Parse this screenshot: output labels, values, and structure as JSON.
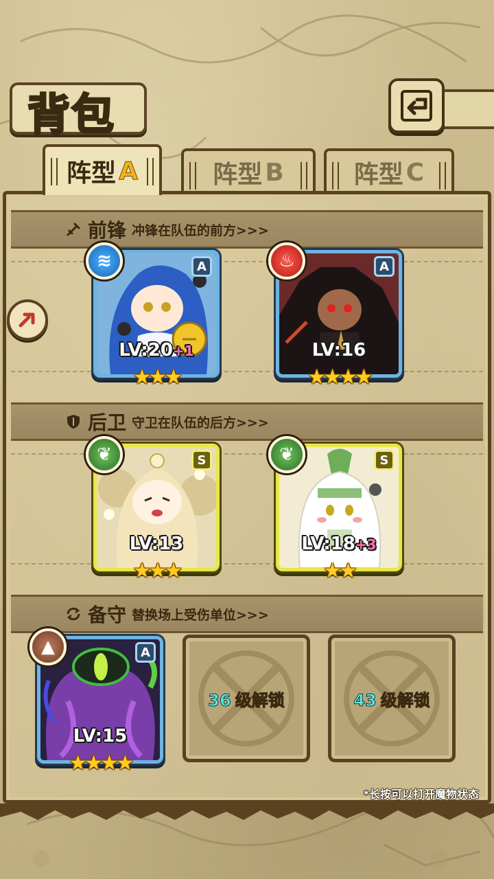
{
  "header": {
    "title": "背包",
    "back_icon": "back-arrow-icon"
  },
  "tabs": [
    {
      "label": "阵型",
      "letter": "A",
      "active": true
    },
    {
      "label": "阵型",
      "letter": "B",
      "active": false
    },
    {
      "label": "阵型",
      "letter": "C",
      "active": false
    }
  ],
  "sections": {
    "front": {
      "name": "前锋",
      "desc": "冲锋在队伍的前方>>>",
      "icon": "sword-icon"
    },
    "back": {
      "name": "后卫",
      "desc": "守卫在队伍的后方>>>",
      "icon": "shield-icon"
    },
    "reserve": {
      "name": "备守",
      "desc": "替换场上受伤单位>>>",
      "icon": "swap-icon"
    }
  },
  "monsters": [
    {
      "grade": "A",
      "element": "water",
      "level": "LV:20",
      "bonus": "+1",
      "stars": "★★★"
    },
    {
      "grade": "A",
      "element": "fire",
      "level": "LV:16",
      "bonus": "",
      "stars": "★★★★"
    },
    {
      "grade": "S",
      "element": "leaf",
      "level": "LV:13",
      "bonus": "",
      "stars": "★★★"
    },
    {
      "grade": "S",
      "element": "leaf",
      "level": "LV:18",
      "bonus": "+3",
      "stars": "★★"
    },
    {
      "grade": "A",
      "element": "earth",
      "level": "LV:15",
      "bonus": "",
      "stars": "★★★★"
    }
  ],
  "locked_slots": [
    {
      "level": "36",
      "text": "级解锁"
    },
    {
      "level": "43",
      "text": "级解锁"
    }
  ],
  "hint": "*长按可以打开魔物状态",
  "colors": {
    "parchment": "#c9b88a",
    "frame": "#5a4220",
    "rare_border": "#6fb4e0",
    "super_border": "#e9e64a",
    "accent_gold": "#f3b41a"
  }
}
